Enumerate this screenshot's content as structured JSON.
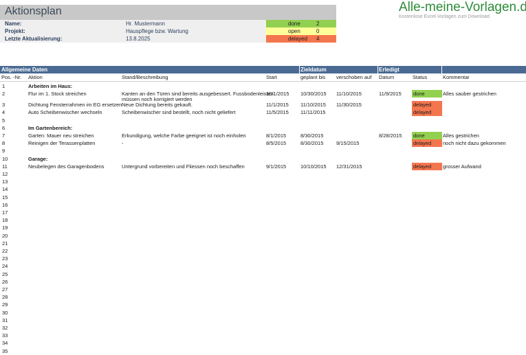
{
  "header": {
    "title": "Aktionsplan",
    "name_label": "Name:",
    "name_value": "Hr. Mustermann",
    "project_label": "Projekt:",
    "project_value": "Hauspflege bzw. Wartung",
    "updated_label": "Letzte Aktualisierung:",
    "updated_value": "13.8.2025"
  },
  "summary": [
    {
      "label": "done",
      "count": "2",
      "color": "#92d050"
    },
    {
      "label": "open",
      "count": "0",
      "color": "#ffff99"
    },
    {
      "label": "delayed",
      "count": "4",
      "color": "#f4764f"
    }
  ],
  "logo": {
    "title": "Alle-meine-Vorlagen.de",
    "subtitle": "Kostenlose Excel-Vorlagen zum Download"
  },
  "sections": {
    "general": "Allgemeine Daten",
    "target": "Zieldatum",
    "done": "Erledigt"
  },
  "columns": {
    "pos": "Pos. -Nr.",
    "action": "Aktion",
    "desc": "Stand/Beschreibung",
    "start": "Start",
    "planned": "geplant bis",
    "postponed": "verschoben auf",
    "date": "Datum",
    "status": "Status",
    "comment": "Kommentar"
  },
  "status_colors": {
    "done": "#92d050",
    "delayed": "#f4764f"
  },
  "rows": [
    {
      "n": "1",
      "action": "Arbeiten im Haus:",
      "group": true
    },
    {
      "n": "2",
      "action": "Flur im 1. Stock streichen",
      "desc": "Kanten an den Türen sind bereits ausgebessert. Fussbodenleisten",
      "desc2": "müssen noch korrigiert werden",
      "start": "10/1/2015",
      "planned": "10/30/2015",
      "postponed": "11/10/2015",
      "date": "11/9/2015",
      "status": "done",
      "comment": "Alles sauber gestrichen"
    },
    {
      "n": "3",
      "action": "Dichtung Fensterrahmen im EG ersetzen",
      "desc": "Neue Dichtung bereits gekauft.",
      "start": "11/1/2015",
      "planned": "11/10/2015",
      "postponed": "11/30/2015",
      "status": "delayed"
    },
    {
      "n": "4",
      "action": "Auto Scheibenwischer wechseln",
      "desc": "Scheibenwischer sind bestellt, noch nicht geliefert",
      "start": "11/5/2015",
      "planned": "11/11/2015",
      "status": "delayed"
    },
    {
      "n": "5"
    },
    {
      "n": "6",
      "action": "Im Gartenbereich:",
      "group": true
    },
    {
      "n": "7",
      "action": "Garten: Mauer neu streichen",
      "desc": "Erkundigung, welche Farbe geeignet ist noch einholen",
      "start": "8/1/2015",
      "planned": "8/30/2015",
      "date": "8/28/2015",
      "status": "done",
      "comment": "Alles gestrichen"
    },
    {
      "n": "8",
      "action": "Reinigen der Terassenplatten",
      "desc": "  -",
      "start": "8/5/2015",
      "planned": "8/30/2015",
      "postponed": "9/15/2015",
      "status": "delayed",
      "comment": "noch nicht dazu gekommen"
    },
    {
      "n": "9"
    },
    {
      "n": "10",
      "action": "Garage:",
      "group": true
    },
    {
      "n": "11",
      "action": "Neubelegen des Garagenbodens",
      "desc": "Untergrund vorbereiten und Fliessen noch beschaffen",
      "start": "9/1/2015",
      "planned": "10/10/2015",
      "postponed": "12/31/2015",
      "status": "delayed",
      "comment": "grosser Aufwand"
    },
    {
      "n": "12"
    },
    {
      "n": "13"
    },
    {
      "n": "14"
    },
    {
      "n": "15"
    },
    {
      "n": "16"
    },
    {
      "n": "17"
    },
    {
      "n": "18"
    },
    {
      "n": "19"
    },
    {
      "n": "20"
    },
    {
      "n": "21"
    },
    {
      "n": "22"
    },
    {
      "n": "23"
    },
    {
      "n": "24"
    },
    {
      "n": "25"
    },
    {
      "n": "26"
    },
    {
      "n": "27"
    },
    {
      "n": "28"
    },
    {
      "n": "29"
    },
    {
      "n": "30"
    },
    {
      "n": "31"
    },
    {
      "n": "32"
    },
    {
      "n": "33"
    },
    {
      "n": "34"
    },
    {
      "n": "35"
    }
  ]
}
